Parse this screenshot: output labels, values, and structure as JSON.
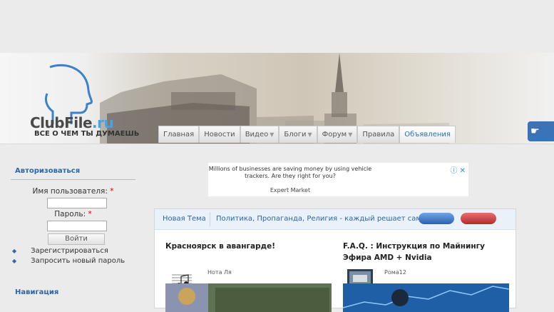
{
  "logo": {
    "main": "ClubFile",
    "suffix": ".ru",
    "slogan": "ВСЕ О ЧЕМ ТЫ ДУМАЕШЬ"
  },
  "nav": {
    "items": [
      {
        "label": "Главная",
        "dropdown": false
      },
      {
        "label": "Новости",
        "dropdown": false
      },
      {
        "label": "Видео",
        "dropdown": true
      },
      {
        "label": "Блоги",
        "dropdown": true
      },
      {
        "label": "Форум",
        "dropdown": true
      },
      {
        "label": "Правила",
        "dropdown": false
      },
      {
        "label": "Объявления",
        "dropdown": false,
        "active": true
      }
    ],
    "dropdown_glyph": "▼"
  },
  "login": {
    "title": "Авторизоваться",
    "username_label": "Имя пользователя:",
    "password_label": "Пароль:",
    "required_mark": "*",
    "submit": "Войти",
    "links": [
      "Зарегистрироваться",
      "Запросить новый пароль"
    ]
  },
  "navigation_title": "Навигация",
  "ad": {
    "copy": "Millions of businesses are saving money by using vehicle trackers. Are they right for you?",
    "brand": "Expert Market",
    "icons": "ⓘ ✕"
  },
  "tabs": {
    "new_topic": "Новая Тема",
    "topic": "Политика, Пропаганда, Религия - каждый решает сам"
  },
  "posts": [
    {
      "title": "Красноярск в авангарде!",
      "author": "Нота Ля"
    },
    {
      "title": "F.A.Q. : Инструкция по Майнингу Эфира AMD + Nvidia",
      "author": "Рома12"
    }
  ],
  "colors": {
    "accent": "#2d66a8",
    "share": "#3a73b8",
    "pill_blue": "#2d5fb0",
    "pill_red": "#b02d2d"
  }
}
